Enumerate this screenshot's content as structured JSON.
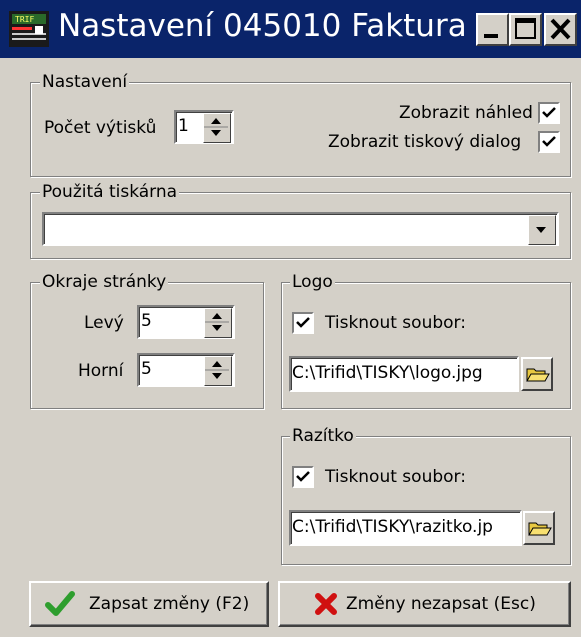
{
  "window": {
    "title": "Nastavení 045010 Faktura"
  },
  "nastaveni": {
    "legend": "Nastavení",
    "copies_label": "Počet výtisků",
    "copies_value": "1",
    "preview_label": "Zobrazit náhled",
    "preview_checked": true,
    "dialog_label": "Zobrazit tiskový dialog",
    "dialog_checked": true
  },
  "printer": {
    "legend": "Použitá tiskárna",
    "value": ""
  },
  "margins": {
    "legend": "Okraje stránky",
    "left_label": "Levý",
    "left_value": "5",
    "top_label": "Horní",
    "top_value": "5"
  },
  "logo": {
    "legend": "Logo",
    "print_label": "Tisknout soubor:",
    "print_checked": true,
    "path": "C:\\Trifid\\TISKY\\logo.jpg"
  },
  "razitko": {
    "legend": "Razítko",
    "print_label": "Tisknout soubor:",
    "print_checked": true,
    "path": "C:\\Trifid\\TISKY\\razitko.jp"
  },
  "buttons": {
    "save_label": "Zapsat změny (F2)",
    "cancel_label": "Změny nezapsat (Esc)"
  },
  "colors": {
    "titlebar": "#0a246a",
    "face": "#d4d0c8",
    "save_check": "#2e9e2e",
    "cancel_x": "#d01010"
  },
  "icons": [
    "app-icon",
    "minimize-icon",
    "maximize-icon",
    "close-icon",
    "spin-arrows-icon",
    "dropdown-arrow-icon",
    "checkmark-icon",
    "folder-open-icon",
    "green-check-icon",
    "red-x-icon"
  ]
}
